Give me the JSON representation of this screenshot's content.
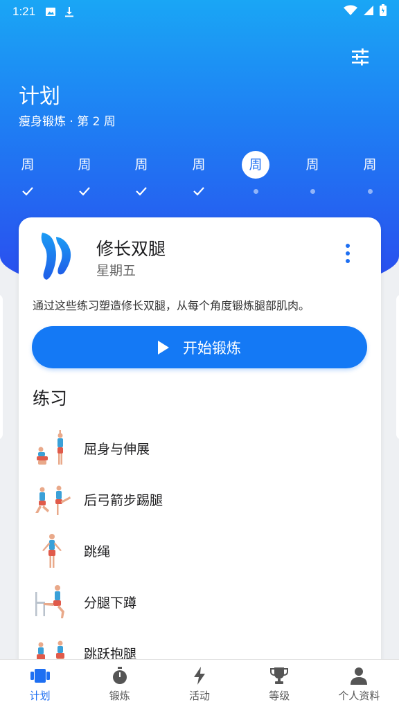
{
  "status_bar": {
    "time": "1:21"
  },
  "header": {
    "title": "计划",
    "subtitle": "瘦身锻炼 · 第 2 周"
  },
  "week": {
    "days": [
      {
        "label": "周",
        "state": "done"
      },
      {
        "label": "周",
        "state": "done"
      },
      {
        "label": "周",
        "state": "done"
      },
      {
        "label": "周",
        "state": "done"
      },
      {
        "label": "周",
        "state": "today"
      },
      {
        "label": "周",
        "state": "upcoming"
      },
      {
        "label": "周",
        "state": "upcoming"
      }
    ]
  },
  "workout_card": {
    "title": "修长双腿",
    "day": "星期五",
    "description": "通过这些练习塑造修长双腿，从每个角度锻炼腿部肌肉。",
    "start_label": "开始锻炼",
    "section_title": "练习",
    "exercises": [
      {
        "name": "屈身与伸展"
      },
      {
        "name": "后弓箭步踢腿"
      },
      {
        "name": "跳绳"
      },
      {
        "name": "分腿下蹲"
      },
      {
        "name": "跳跃抱腿"
      }
    ]
  },
  "bottom_nav": {
    "items": [
      {
        "label": "计划",
        "icon": "plan-icon",
        "active": true
      },
      {
        "label": "锻炼",
        "icon": "stopwatch-icon",
        "active": false
      },
      {
        "label": "活动",
        "icon": "lightning-icon",
        "active": false
      },
      {
        "label": "等级",
        "icon": "trophy-icon",
        "active": false
      },
      {
        "label": "个人资料",
        "icon": "person-icon",
        "active": false
      }
    ]
  },
  "colors": {
    "accent": "#1e6ff2",
    "button": "#1479f5",
    "hero_top": "#1aa6f5",
    "hero_bottom": "#2b49ee"
  }
}
